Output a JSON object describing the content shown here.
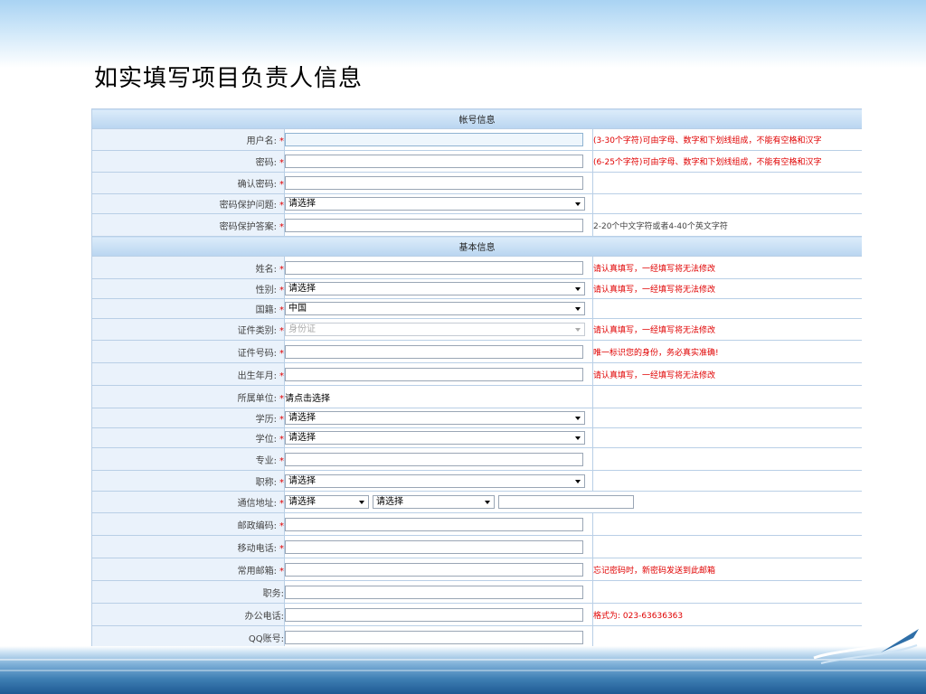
{
  "page": {
    "title": "如实填写项目负责人信息"
  },
  "sections": {
    "account": "帐号信息",
    "basic": "基本信息"
  },
  "rows": {
    "username": {
      "label": "用户名:",
      "required": "*",
      "hint": "(3-30个字符)可由字母、数字和下划线组成，不能有空格和汉字"
    },
    "password": {
      "label": "密码:",
      "required": "*",
      "hint": "(6-25个字符)可由字母、数字和下划线组成，不能有空格和汉字"
    },
    "confirm_password": {
      "label": "确认密码:",
      "required": "*"
    },
    "security_question": {
      "label": "密码保护问题:",
      "required": "*",
      "value": "请选择"
    },
    "security_answer": {
      "label": "密码保护答案:",
      "required": "*",
      "hint": "2-20个中文字符或者4-40个英文字符"
    },
    "name": {
      "label": "姓名:",
      "required": "*",
      "hint": "请认真填写，一经填写将无法修改"
    },
    "gender": {
      "label": "性别:",
      "required": "*",
      "value": "请选择",
      "hint": "请认真填写，一经填写将无法修改"
    },
    "nationality": {
      "label": "国籍:",
      "required": "*",
      "value": "中国"
    },
    "id_type": {
      "label": "证件类别:",
      "required": "*",
      "value": "身份证",
      "hint": "请认真填写，一经填写将无法修改"
    },
    "id_number": {
      "label": "证件号码:",
      "required": "*",
      "hint": "唯一标识您的身份，务必真实准确!"
    },
    "birth_date": {
      "label": "出生年月:",
      "required": "*",
      "hint": "请认真填写，一经填写将无法修改"
    },
    "organization": {
      "label": "所属单位:",
      "required": "*",
      "value": "请点击选择"
    },
    "education": {
      "label": "学历:",
      "required": "*",
      "value": "请选择"
    },
    "degree": {
      "label": "学位:",
      "required": "*",
      "value": "请选择"
    },
    "major": {
      "label": "专业:",
      "required": "*"
    },
    "title": {
      "label": "职称:",
      "required": "*",
      "value": "请选择"
    },
    "address": {
      "label": "通信地址:",
      "required": "*",
      "province": "请选择",
      "city": "请选择"
    },
    "postcode": {
      "label": "邮政编码:",
      "required": "*"
    },
    "mobile": {
      "label": "移动电话:",
      "required": "*"
    },
    "email": {
      "label": "常用邮箱:",
      "required": "*",
      "hint": "忘记密码时，新密码发送到此邮箱"
    },
    "position": {
      "label": "职务:"
    },
    "office_phone": {
      "label": "办公电话:",
      "hint": "格式为: 023-63636363"
    },
    "qq": {
      "label": "QQ账号:"
    }
  },
  "colors": {
    "required": "#e00000",
    "label_bg": "#eaf2fb",
    "section_bg": "#b9d5f0",
    "border": "#b9cfe6"
  }
}
